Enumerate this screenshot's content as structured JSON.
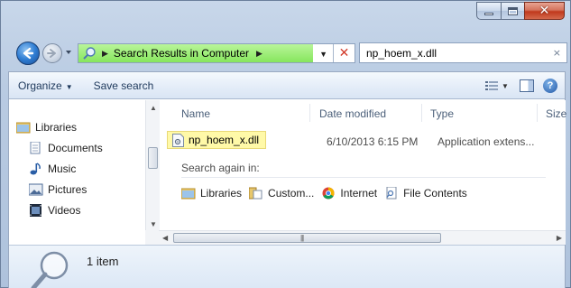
{
  "window": {
    "caption_buttons": [
      "minimize",
      "maximize",
      "close"
    ]
  },
  "address_bar": {
    "path": "Search Results in Computer",
    "icon": "search-icon",
    "clear_glyph": "✕"
  },
  "search_box": {
    "value": "np_hoem_x.dll",
    "clear_glyph": "×"
  },
  "toolbar": {
    "organize": "Organize",
    "save_search": "Save search",
    "help": "?"
  },
  "nav_pane": {
    "items": [
      {
        "label": "Libraries",
        "icon": "libraries-icon"
      },
      {
        "label": "Documents",
        "icon": "documents-icon"
      },
      {
        "label": "Music",
        "icon": "music-icon"
      },
      {
        "label": "Pictures",
        "icon": "pictures-icon"
      },
      {
        "label": "Videos",
        "icon": "videos-icon"
      }
    ]
  },
  "file_list": {
    "columns": [
      "Name",
      "Date modified",
      "Type",
      "Size"
    ],
    "rows": [
      {
        "name": "np_hoem_x.dll",
        "date": "6/10/2013 6:15 PM",
        "type": "Application extens...",
        "icon": "dll-file-icon"
      }
    ],
    "search_again_label": "Search again in:",
    "search_again_items": [
      {
        "label": "Libraries",
        "icon": "libraries-icon"
      },
      {
        "label": "Custom...",
        "icon": "custom-folder-icon"
      },
      {
        "label": "Internet",
        "icon": "internet-icon"
      },
      {
        "label": "File Contents",
        "icon": "file-contents-icon"
      }
    ]
  },
  "details_pane": {
    "count_text": "1 item",
    "icon": "search-magnifier-icon"
  },
  "colors": {
    "highlight": "#fff9a8",
    "address_progress": "#86e65d",
    "close_button": "#c1391c"
  }
}
